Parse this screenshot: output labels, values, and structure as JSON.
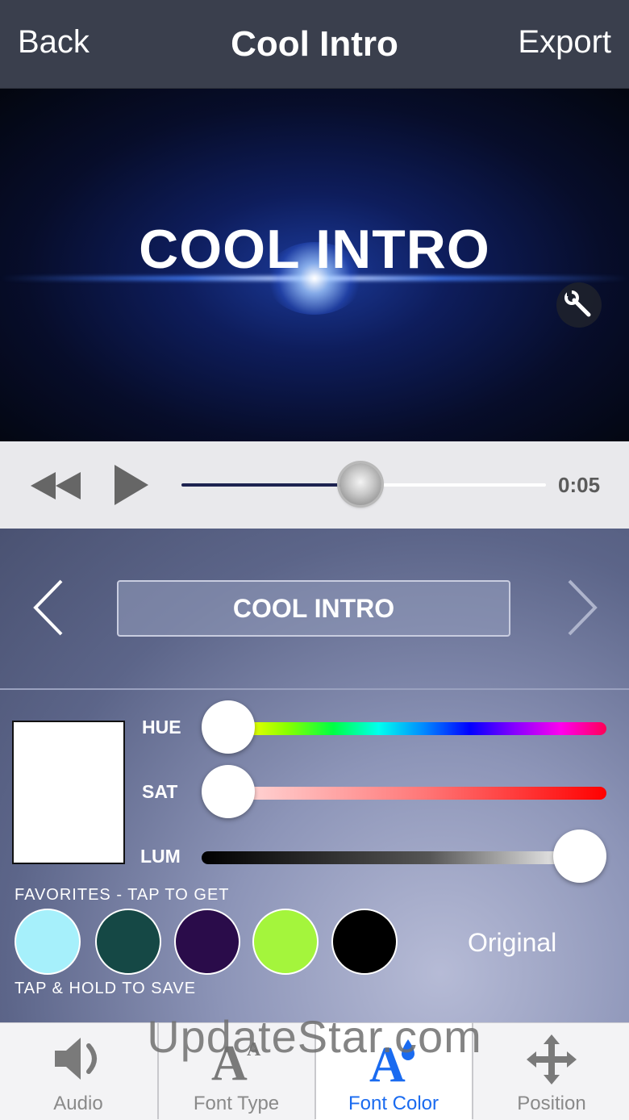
{
  "nav": {
    "back_label": "Back",
    "title": "Cool Intro",
    "export_label": "Export"
  },
  "preview": {
    "overlay_text": "COOL INTRO",
    "settings_icon": "wrench-icon"
  },
  "playback": {
    "rewind_icon": "rewind-icon",
    "play_icon": "play-icon",
    "time": "0:05",
    "progress": 0.49
  },
  "editor": {
    "text_value": "COOL INTRO",
    "prev_icon": "chevron-left-icon",
    "next_icon": "chevron-right-icon",
    "preview_color": "#ffffff",
    "sliders": {
      "hue": {
        "label": "HUE",
        "value": 0.0
      },
      "sat": {
        "label": "SAT",
        "value": 0.0
      },
      "lum": {
        "label": "LUM",
        "value": 1.0
      }
    },
    "favorites_title": "FAVORITES - TAP TO GET",
    "favorites_hint": "TAP & HOLD TO SAVE",
    "favorites": [
      "#a6f0fb",
      "#154845",
      "#2a0c4a",
      "#a4f53c",
      "#000000"
    ],
    "original_label": "Original"
  },
  "tabs": [
    {
      "label": "Audio",
      "icon": "speaker-icon"
    },
    {
      "label": "Font Type",
      "icon": "font-type-icon"
    },
    {
      "label": "Font Color",
      "icon": "font-color-icon",
      "active": true
    },
    {
      "label": "Position",
      "icon": "move-arrows-icon"
    }
  ],
  "watermark": "UpdateStar.com",
  "colors": {
    "accent": "#1a6bf0",
    "nav_bg": "#3a3f4d"
  }
}
